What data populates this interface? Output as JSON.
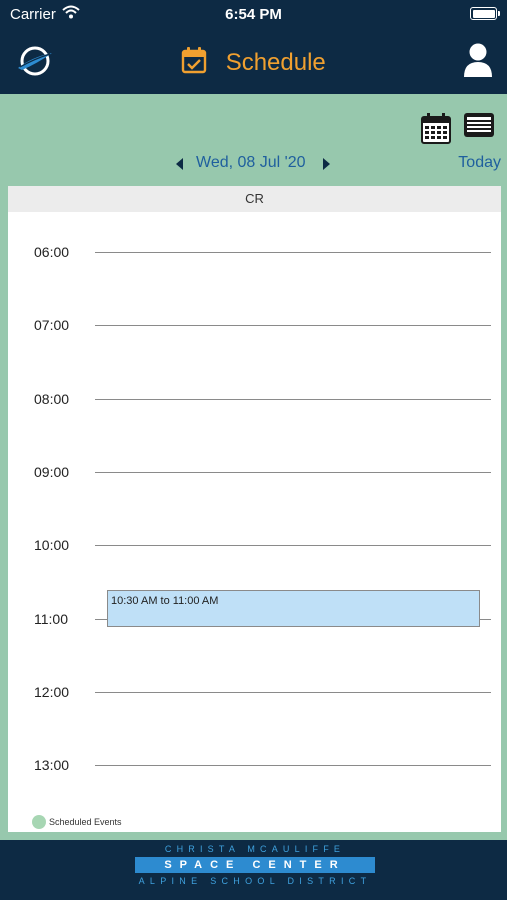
{
  "status_bar": {
    "carrier": "Carrier",
    "time": "6:54 PM"
  },
  "nav": {
    "title": "Schedule",
    "title_color": "#f0a030",
    "icons": [
      "logo-icon",
      "calendar-check-icon",
      "user-icon"
    ]
  },
  "toolbar": {
    "views": [
      "calendar-view-icon",
      "list-view-icon"
    ]
  },
  "date_nav": {
    "date": "Wed, 08 Jul '20",
    "today_label": "Today"
  },
  "calendar": {
    "column_header": "CR",
    "hours": [
      "06:00",
      "07:00",
      "08:00",
      "09:00",
      "10:00",
      "11:00",
      "12:00",
      "13:00"
    ],
    "events": [
      {
        "label": "10:30 AM to 11:00 AM",
        "color": "#bfe0f7"
      }
    ]
  },
  "legend": {
    "label": "Scheduled Events",
    "color": "#a7d6b3"
  },
  "footer": {
    "line1": "CHRISTA MCAULIFFE",
    "line2": "SPACE CENTER",
    "line3": "ALPINE SCHOOL DISTRICT"
  },
  "colors": {
    "navy": "#0d2a44",
    "mint": "#97c8ad",
    "link_blue": "#1f5f9e"
  }
}
